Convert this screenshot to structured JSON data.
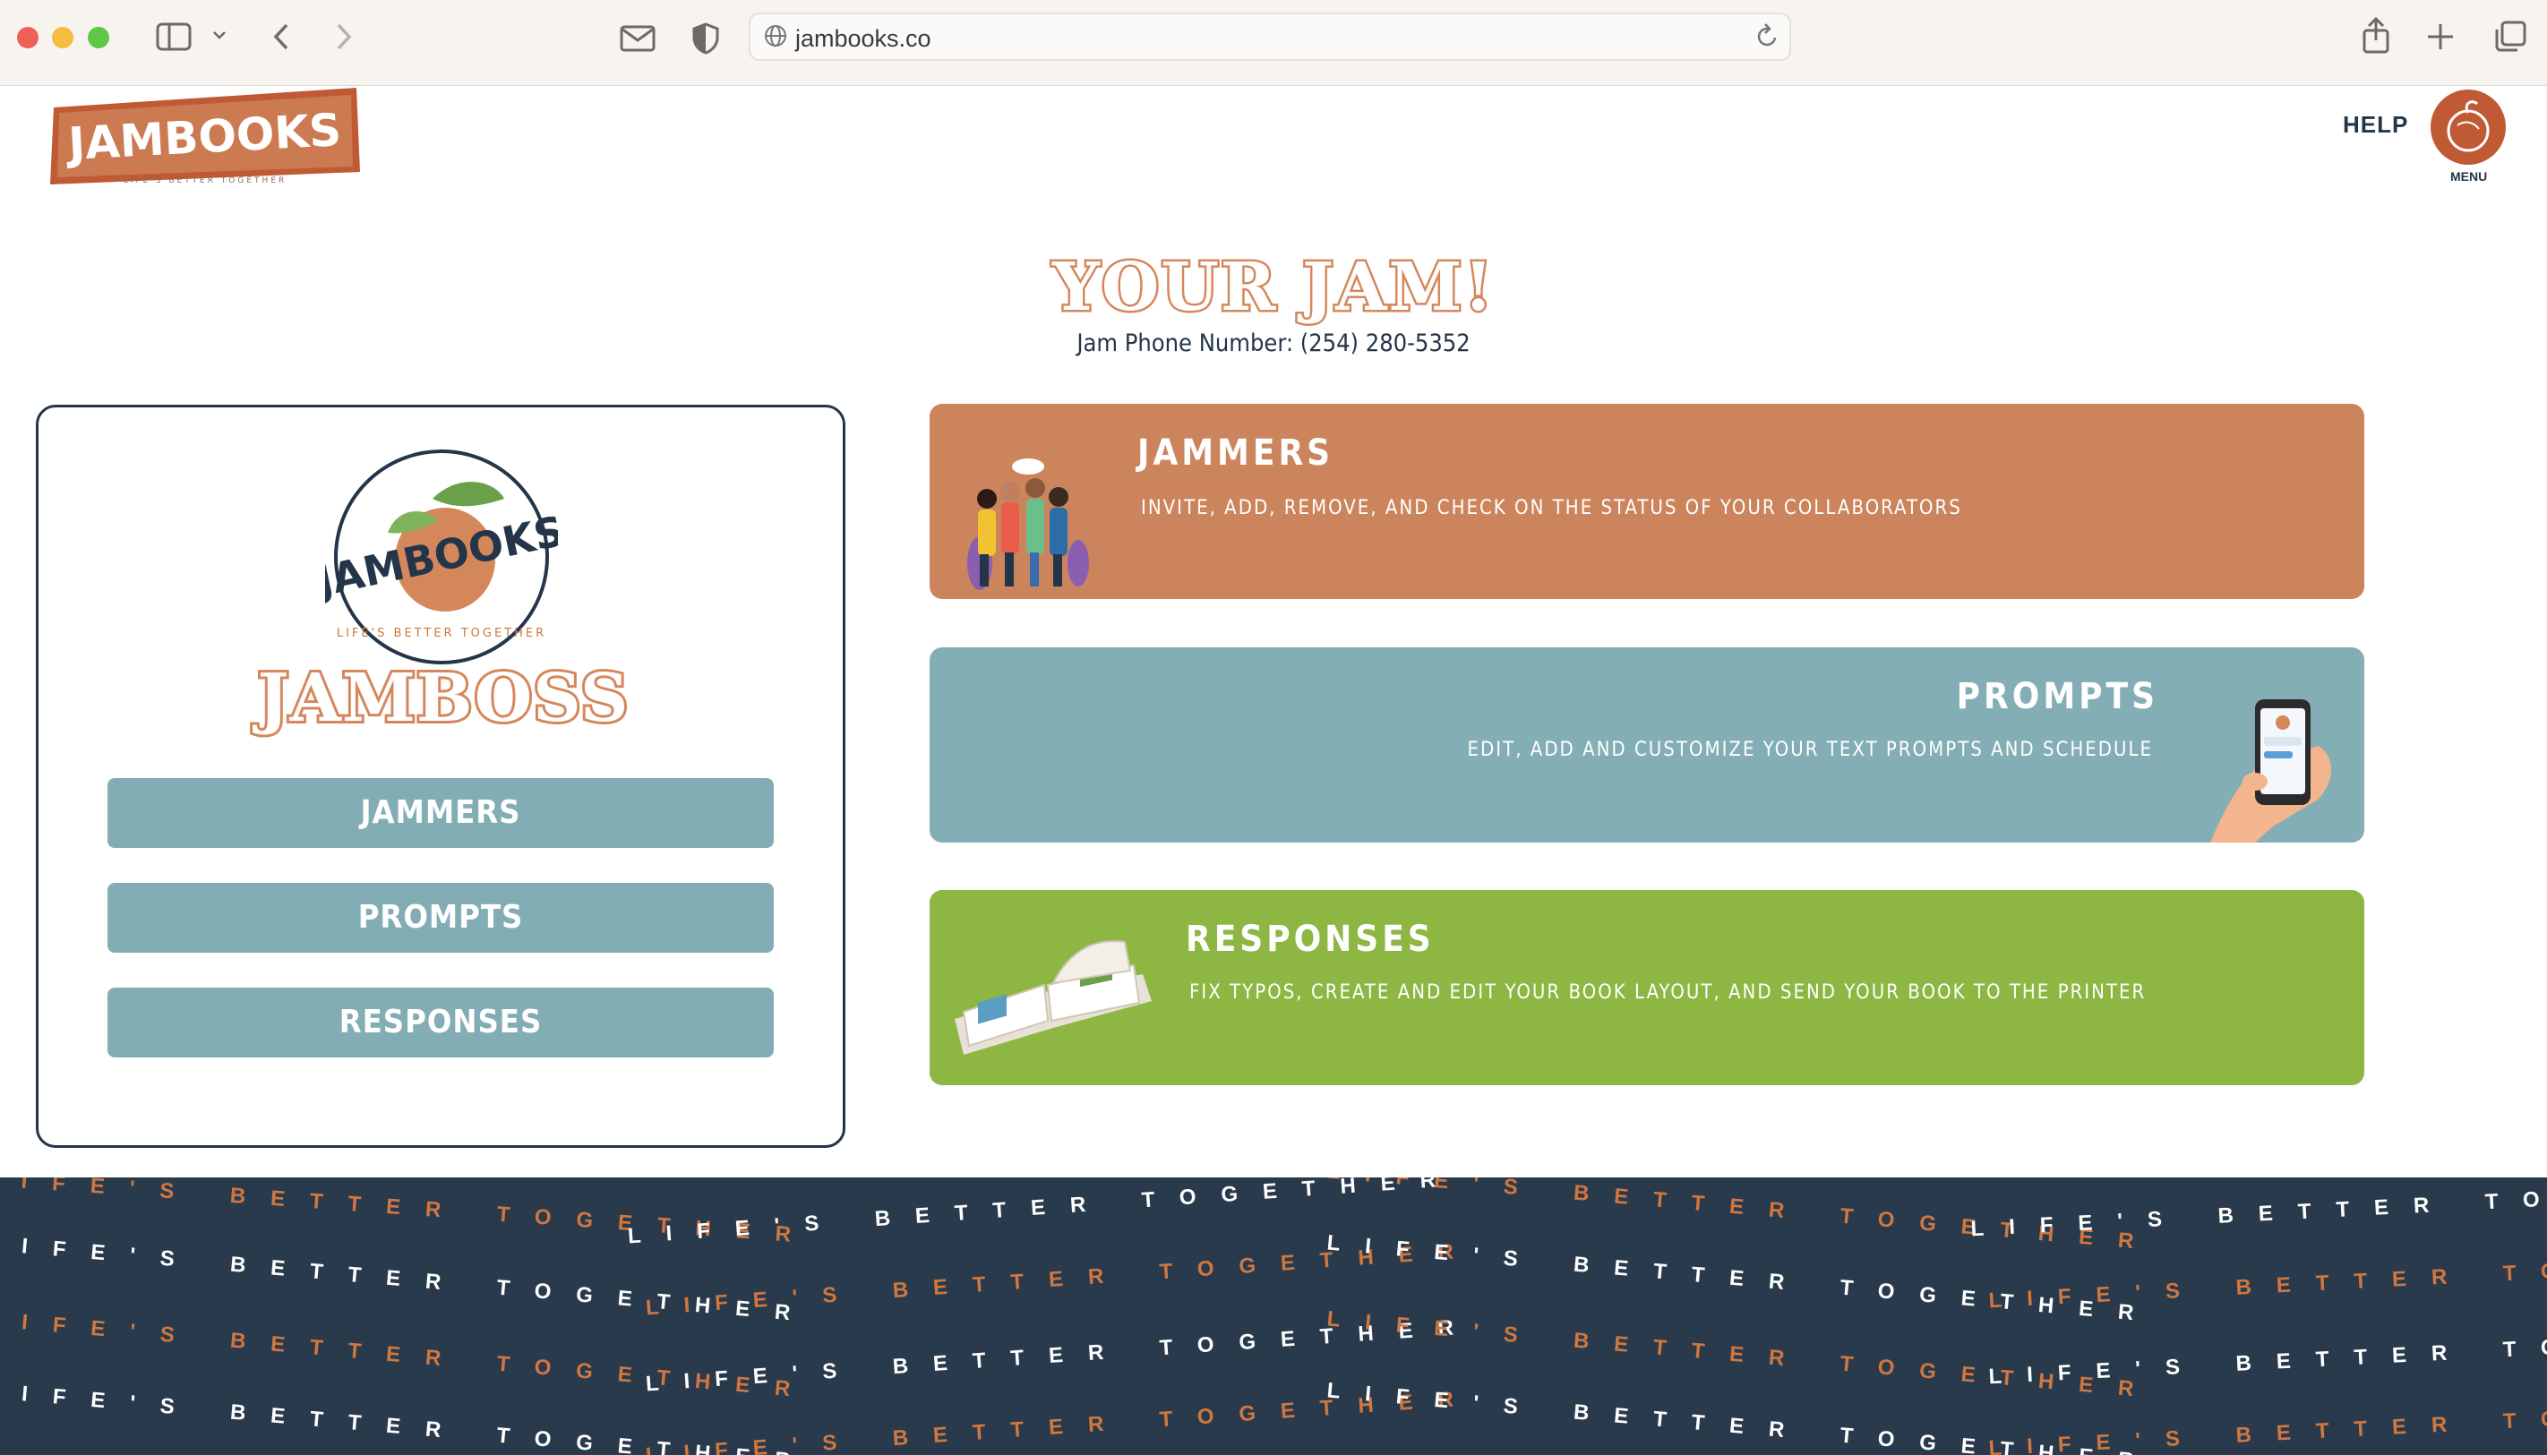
{
  "browser": {
    "url": "jambooks.co",
    "icons": [
      "sidebar-icon",
      "chevron-down-icon",
      "back-icon",
      "forward-icon",
      "mail-icon",
      "shield-icon",
      "globe-icon",
      "reload-icon",
      "share-icon",
      "new-tab-icon",
      "tabs-overview-icon"
    ]
  },
  "header": {
    "logo_text": "JAMBOOKS",
    "logo_tagline": "LIFE'S BETTER TOGETHER",
    "help_label": "HELP",
    "menu_label": "MENU"
  },
  "hero": {
    "title": "YOUR JAM!",
    "phone_text": "Jam Phone Number: (254) 280-5352"
  },
  "sidebar": {
    "badge_text": "JAMBOOKS",
    "badge_tagline": "LIFE'S BETTER TOGETHER",
    "role_title": "JAMBOSS",
    "buttons": [
      {
        "label": "JAMMERS"
      },
      {
        "label": "PROMPTS"
      },
      {
        "label": "RESPONSES"
      }
    ]
  },
  "panels": [
    {
      "title": "JAMMERS",
      "description": "INVITE, ADD, REMOVE, AND CHECK ON THE STATUS OF YOUR COLLABORATORS",
      "color": "#cc845d"
    },
    {
      "title": "PROMPTS",
      "description": "EDIT, ADD AND CUSTOMIZE YOUR TEXT PROMPTS AND SCHEDULE",
      "color": "#84aeb5"
    },
    {
      "title": "RESPONSES",
      "description": "FIX TYPOS, CREATE AND EDIT YOUR BOOK LAYOUT, AND SEND YOUR BOOK TO THE PRINTER",
      "color": "#8db643"
    }
  ],
  "footer": {
    "pattern_text": "LIFE'S BETTER TOGETHER",
    "colors": {
      "background": "#293a4c",
      "accent": "#d0773f",
      "light": "#ffffff"
    }
  },
  "colors": {
    "brand_orange": "#bf5a34",
    "title_orange": "#d5875c",
    "navy": "#24354a",
    "teal_button": "#83adb4"
  }
}
